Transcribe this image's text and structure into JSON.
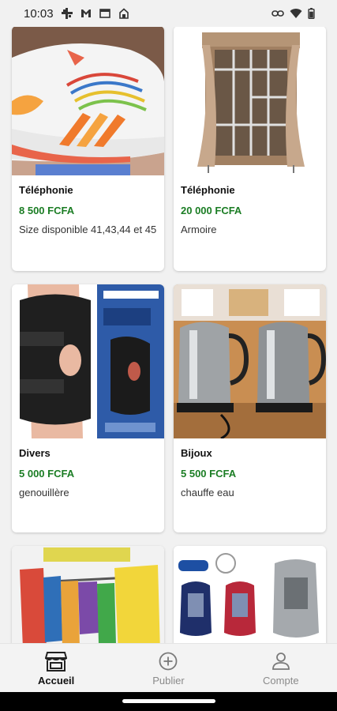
{
  "status_bar": {
    "time": "10:03",
    "left_icons": [
      "slack-icon",
      "gmail-icon",
      "screen-cast-icon",
      "home-icon"
    ],
    "right_icons": [
      "link-icon",
      "wifi-icon",
      "battery-icon"
    ]
  },
  "listings": [
    {
      "category": "Téléphonie",
      "price": "8 500 FCFA",
      "description": "Size disponible 41,43,44 et 45",
      "image": "sneaker-photo"
    },
    {
      "category": "Téléphonie",
      "price": "20 000 FCFA",
      "description": "Armoire",
      "image": "wardrobe-photo"
    },
    {
      "category": "Divers",
      "price": "5 000 FCFA",
      "description": "genouillère",
      "image": "knee-brace-photo"
    },
    {
      "category": "Bijoux",
      "price": "5 500 FCFA",
      "description": "chauffe eau",
      "image": "kettle-photo"
    },
    {
      "category": "",
      "price": "",
      "description": "",
      "image": "clothes-rack-photo"
    },
    {
      "category": "",
      "price": "",
      "description": "",
      "image": "baby-carrier-photo"
    }
  ],
  "bottom_nav": {
    "items": [
      {
        "label": "Accueil",
        "icon": "store-icon",
        "active": true
      },
      {
        "label": "Publier",
        "icon": "add-circle-icon",
        "active": false
      },
      {
        "label": "Compte",
        "icon": "person-icon",
        "active": false
      }
    ]
  },
  "colors": {
    "price_green": "#1b7d24",
    "background": "#f1f1f1",
    "card": "#ffffff"
  }
}
